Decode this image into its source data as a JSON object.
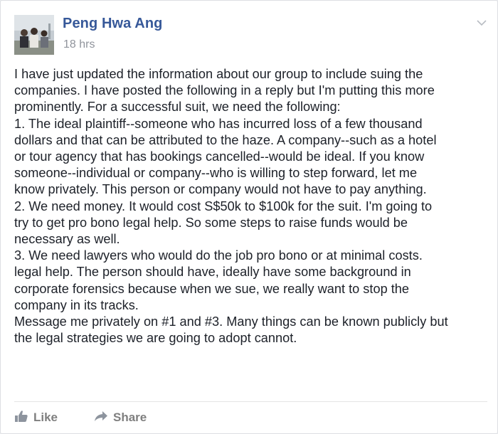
{
  "post": {
    "author": "Peng Hwa Ang",
    "timestamp": "18 hrs",
    "body_lines": [
      "I have just updated the information about our group to include suing the",
      "companies. I have posted the following in a reply but I'm putting this more",
      "prominently. For a successful suit, we need the following:",
      "1. The ideal plaintiff--someone who has incurred loss of a few thousand",
      "dollars and that can be attributed to the haze. A company--such as a hotel",
      "or tour agency that has bookings cancelled--would be ideal. If you know",
      "someone--individual or company--who is willing to step forward, let me",
      "know privately. This person or company would not have to pay anything.",
      "2. We need money. It would cost S$50k to $100k for the suit. I'm going to",
      "try to get pro bono legal help. So some steps to raise funds would be",
      "necessary as well.",
      "3. We need lawyers who would do the job pro bono or at minimal costs.",
      "legal help. The person should have, ideally have some background in",
      "corporate forensics because when we sue, we really want to stop the",
      "company in its tracks.",
      "Message me privately on #1 and #3. Many things can be known publicly but",
      "the legal strategies we are going to adopt cannot."
    ]
  },
  "actions": {
    "like_label": "Like",
    "share_label": "Share"
  },
  "icons": {
    "like": "thumbs-up-icon",
    "share": "share-arrow-icon",
    "menu": "chevron-down-icon"
  },
  "colors": {
    "author_link": "#365899",
    "timestamp": "#90949c",
    "body_text": "#1d2129",
    "action_text": "#7f7f7f"
  }
}
